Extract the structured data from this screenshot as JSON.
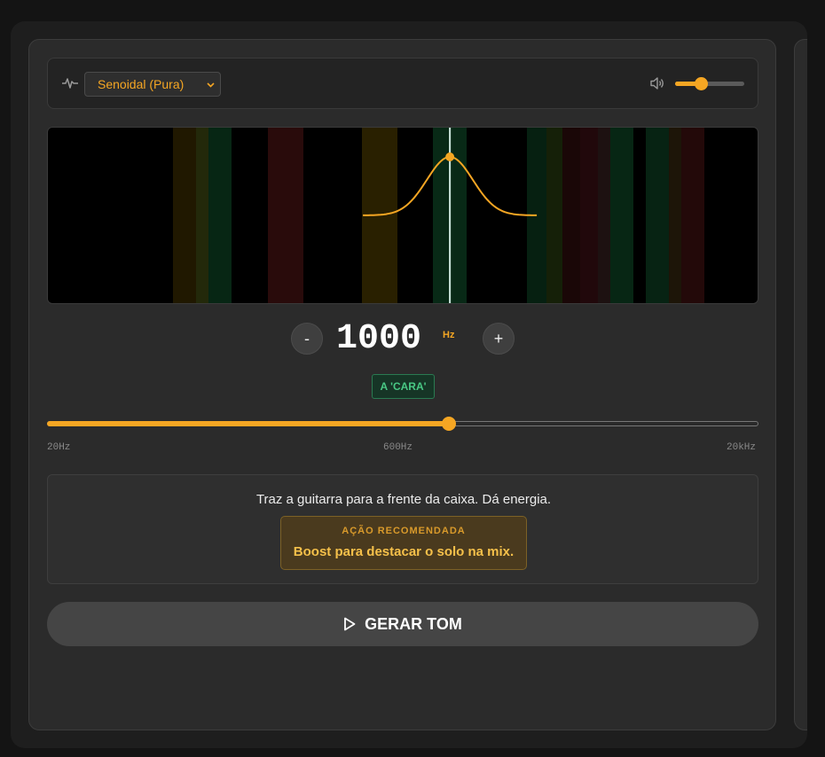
{
  "toolbar": {
    "wave_icon": "waveform-icon",
    "waveform_selected": "Senoidal (Pura)",
    "chevron_icon": "chevron-down-icon",
    "speaker_icon": "speaker-icon",
    "volume_level": 0.37
  },
  "visualizer": {
    "frequency_hz": 1000,
    "color_peak": "#f5a623",
    "color_cursor": "#cfe8e0"
  },
  "frequency": {
    "minus_label": "-",
    "value": "1000",
    "unit": "Hz",
    "plus_label": "+",
    "band_badge": "A 'CARA'",
    "slider_position": 0.565,
    "scale_min": "20Hz",
    "scale_mid": "600Hz",
    "scale_max": "20kHz"
  },
  "info": {
    "description": "Traz a guitarra para a frente da caixa. Dá energia.",
    "action_title": "AÇÃO RECOMENDADA",
    "action_text": "Boost para destacar o solo na mix."
  },
  "generate": {
    "play_icon": "play-icon",
    "label": "GERAR TOM"
  },
  "colors": {
    "accent": "#f5a623",
    "badge_green": "#49c985"
  }
}
